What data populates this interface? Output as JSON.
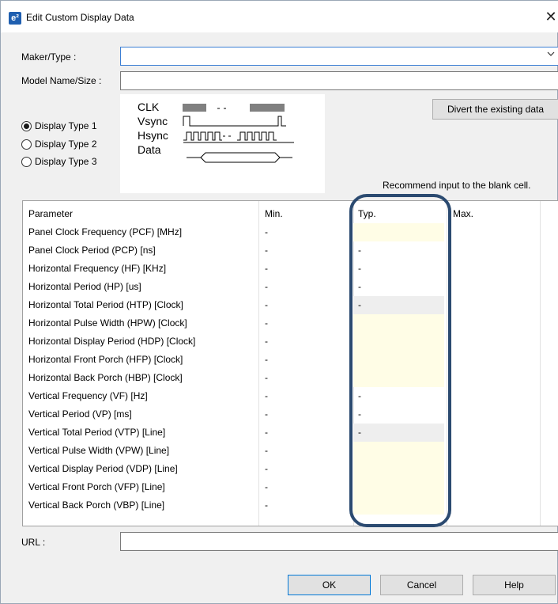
{
  "window": {
    "title": "Edit Custom Display Data",
    "app_icon": "e²",
    "close_glyph": "✕"
  },
  "form": {
    "maker_label": "Maker/Type :",
    "maker_value": "",
    "model_label": "Model Name/Size :",
    "model_value": "",
    "url_label": "URL :",
    "url_value": ""
  },
  "display_types": [
    {
      "label": "Display Type 1",
      "selected": true
    },
    {
      "label": "Display Type 2",
      "selected": false
    },
    {
      "label": "Display Type 3",
      "selected": false
    }
  ],
  "diagram": {
    "clk": "CLK",
    "vsync": "Vsync",
    "hsync": "Hsync",
    "data": "Data"
  },
  "buttons": {
    "divert": "Divert the existing data",
    "ok": "OK",
    "cancel": "Cancel",
    "help": "Help"
  },
  "hint": "Recommend input to the blank cell.",
  "table": {
    "headers": {
      "parameter": "Parameter",
      "min": "Min.",
      "typ": "Typ.",
      "max": "Max."
    },
    "rows": [
      {
        "param": "Panel Clock Frequency (PCF) [MHz]",
        "min": "-",
        "typ": "",
        "typ_state": "input"
      },
      {
        "param": "Panel Clock Period (PCP) [ns]",
        "min": "-",
        "typ": "-",
        "typ_state": "calc"
      },
      {
        "param": "Horizontal Frequency (HF) [KHz]",
        "min": "-",
        "typ": "-",
        "typ_state": "calc"
      },
      {
        "param": "Horizontal Period (HP) [us]",
        "min": "-",
        "typ": "-",
        "typ_state": "calc"
      },
      {
        "param": "Horizontal Total Period (HTP) [Clock]",
        "min": "-",
        "typ": "-",
        "typ_state": "gray"
      },
      {
        "param": "Horizontal Pulse Width (HPW) [Clock]",
        "min": "-",
        "typ": "",
        "typ_state": "input"
      },
      {
        "param": "Horizontal Display Period (HDP) [Clock]",
        "min": "-",
        "typ": "",
        "typ_state": "input"
      },
      {
        "param": "Horizontal Front Porch (HFP) [Clock]",
        "min": "-",
        "typ": "",
        "typ_state": "input"
      },
      {
        "param": "Horizontal Back Porch (HBP) [Clock]",
        "min": "-",
        "typ": "",
        "typ_state": "input"
      },
      {
        "param": "Vertical Frequency (VF) [Hz]",
        "min": "-",
        "typ": "-",
        "typ_state": "calc"
      },
      {
        "param": "Vertical Period (VP) [ms]",
        "min": "-",
        "typ": "-",
        "typ_state": "calc"
      },
      {
        "param": "Vertical Total Period (VTP) [Line]",
        "min": "-",
        "typ": "-",
        "typ_state": "gray"
      },
      {
        "param": "Vertical Pulse Width (VPW) [Line]",
        "min": "-",
        "typ": "",
        "typ_state": "input"
      },
      {
        "param": "Vertical Display Period (VDP) [Line]",
        "min": "-",
        "typ": "",
        "typ_state": "input"
      },
      {
        "param": "Vertical Front Porch (VFP) [Line]",
        "min": "-",
        "typ": "",
        "typ_state": "input"
      },
      {
        "param": "Vertical Back Porch (VBP) [Line]",
        "min": "-",
        "typ": "",
        "typ_state": "input"
      }
    ]
  },
  "colors": {
    "input_cell": "#fffde6",
    "gray_cell": "#eeeeee",
    "highlight": "#2b4a70",
    "focus_border": "#3c7fd4"
  }
}
